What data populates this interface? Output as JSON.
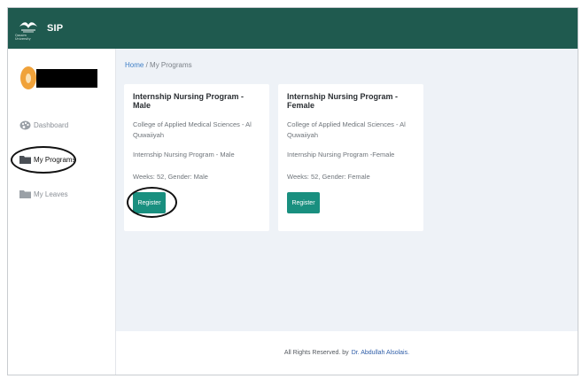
{
  "app": {
    "name": "SIP",
    "logo_caption": "Qassim University"
  },
  "sidebar": {
    "items": [
      {
        "label": "Dashboard",
        "icon": "palette-icon",
        "active": false
      },
      {
        "label": "My Programs",
        "icon": "folder-icon",
        "active": true
      },
      {
        "label": "My Leaves",
        "icon": "folder-icon",
        "active": false
      }
    ]
  },
  "breadcrumb": {
    "home": "Home",
    "separator": "/",
    "current": "My Programs"
  },
  "programs": [
    {
      "title": "Internship Nursing Program - Male",
      "college": "College of Applied Medical Sciences - Al Quwaiiyah",
      "description": "Internship Nursing Program - Male",
      "meta": "Weeks: 52, Gender: Male",
      "button": "Register"
    },
    {
      "title": "Internship Nursing Program -Female",
      "college": "College of Applied Medical Sciences - Al Quwaiiyah",
      "description": "Internship Nursing Program -Female",
      "meta": "Weeks: 52, Gender: Female",
      "button": "Register"
    }
  ],
  "footer": {
    "text": "All Rights Reserved. by",
    "author": "Dr. Abdullah Alsolais."
  },
  "colors": {
    "topbar": "#1f5a4f",
    "accent": "#198f7f",
    "link": "#3e7fc7"
  }
}
